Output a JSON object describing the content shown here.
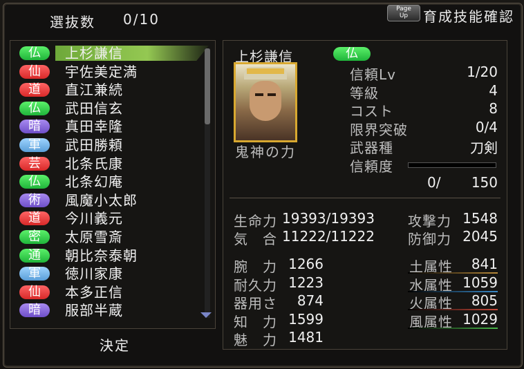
{
  "header": {
    "selection_label": "選抜数",
    "selection_count": "0/10",
    "pageup_line1": "Page",
    "pageup_line2": "Up",
    "skill_check_label": "育成技能確認"
  },
  "list": [
    {
      "badge": "仏",
      "color": "#2ec848",
      "name": "上杉謙信"
    },
    {
      "badge": "仙",
      "color": "#e03c3c",
      "name": "宇佐美定満"
    },
    {
      "badge": "道",
      "color": "#e03c3c",
      "name": "直江兼続"
    },
    {
      "badge": "仏",
      "color": "#2ec848",
      "name": "武田信玄"
    },
    {
      "badge": "暗",
      "color": "#8a6ae0",
      "name": "真田幸隆"
    },
    {
      "badge": "軍",
      "color": "#7ab6ec",
      "name": "武田勝頼"
    },
    {
      "badge": "芸",
      "color": "#e03c3c",
      "name": "北条氏康"
    },
    {
      "badge": "仏",
      "color": "#2ec848",
      "name": "北条幻庵"
    },
    {
      "badge": "術",
      "color": "#8a6ae0",
      "name": "風魔小太郎"
    },
    {
      "badge": "道",
      "color": "#e03c3c",
      "name": "今川義元"
    },
    {
      "badge": "密",
      "color": "#2ec848",
      "name": "太原雪斎"
    },
    {
      "badge": "通",
      "color": "#2ec848",
      "name": "朝比奈泰朝"
    },
    {
      "badge": "軍",
      "color": "#7ab6ec",
      "name": "徳川家康"
    },
    {
      "badge": "仙",
      "color": "#e03c3c",
      "name": "本多正信"
    },
    {
      "badge": "暗",
      "color": "#8a6ae0",
      "name": "服部半蔵"
    }
  ],
  "confirm_label": "決定",
  "detail": {
    "name": "上杉謙信",
    "badge": "仏",
    "skill": "鬼神の力",
    "trust_lv_label": "信頼Lv",
    "trust_lv_value": "1/20",
    "level_label": "等級",
    "level_value": "4",
    "cost_label": "コスト",
    "cost_value": "8",
    "limit_label": "限界突破",
    "limit_value": "0/4",
    "weapon_label": "武器種",
    "weapon_value": "刀剣",
    "trust_label": "信頼度",
    "trust_progress": 0,
    "trust_current": "0/",
    "trust_max": "150"
  },
  "stats": {
    "hp_label": "生命力",
    "hp_value": "19393/19393",
    "ki_label": "気　合",
    "ki_value": "11222/11222",
    "attack_label": "攻撃力",
    "attack_value": "1548",
    "defense_label": "防御力",
    "defense_value": "2045",
    "arm_label": "腕　力",
    "arm_value": "1266",
    "endurance_label": "耐久力",
    "endurance_value": "1223",
    "dexterity_label": "器用さ",
    "dexterity_value": "874",
    "intel_label": "知　力",
    "intel_value": "1599",
    "charm_label": "魅　力",
    "charm_value": "1481",
    "earth_label": "土属性",
    "earth_value": "841",
    "water_label": "水属性",
    "water_value": "1059",
    "fire_label": "火属性",
    "fire_value": "805",
    "wind_label": "風属性",
    "wind_value": "1029"
  }
}
